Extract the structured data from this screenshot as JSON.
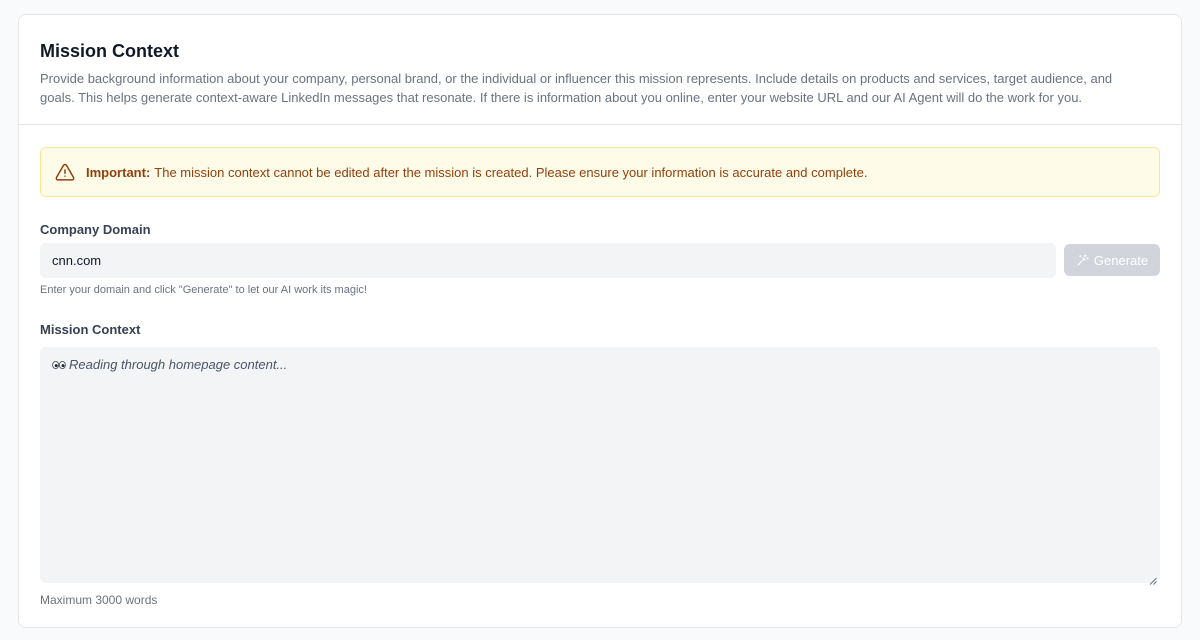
{
  "header": {
    "title": "Mission Context",
    "description": "Provide background information about your company, personal brand, or the individual or influencer this mission represents. Include details on products and services, target audience, and goals. This helps generate context-aware LinkedIn messages that resonate. If there is information about you online, enter your website URL and our AI Agent will do the work for you."
  },
  "alert": {
    "icon": "warning-triangle-icon",
    "strong": "Important:",
    "text": "The mission context cannot be edited after the mission is created. Please ensure your information is accurate and complete."
  },
  "domain": {
    "label": "Company Domain",
    "value": "cnn.com",
    "button_label": "Generate",
    "button_icon": "magic-wand-icon",
    "hint": "Enter your domain and click \"Generate\" to let our AI work its magic!"
  },
  "context": {
    "label": "Mission Context",
    "status_icon": "eyes-icon",
    "status_text": "Reading through homepage content...",
    "footer": "Maximum 3000 words"
  },
  "colors": {
    "alert_bg": "#fefce8",
    "alert_border": "#fde68a",
    "alert_text": "#92400e",
    "input_bg": "#f3f4f6",
    "button_disabled": "#d1d5db"
  }
}
